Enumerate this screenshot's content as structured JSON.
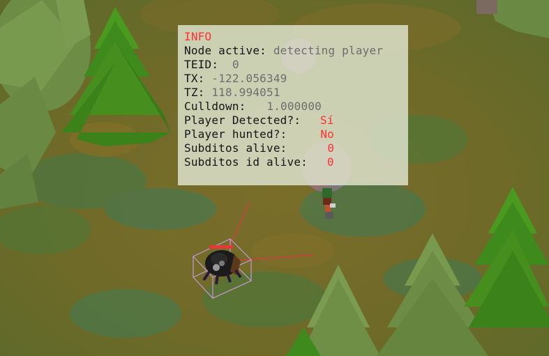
{
  "info_panel": {
    "title": "INFO",
    "rows": [
      {
        "label": "Node active:",
        "value": "detecting player"
      },
      {
        "label": "TEID:",
        "value": "0"
      },
      {
        "label": "TX:",
        "value": "-122.056349"
      },
      {
        "label": "TZ:",
        "value": "118.994051"
      },
      {
        "label": "Culldown:",
        "value": "1.000000"
      },
      {
        "label": "Player Detected?:",
        "value": "Sí"
      },
      {
        "label": "Player hunted?:",
        "value": "No"
      },
      {
        "label": "Subditos alive:",
        "value": "0"
      },
      {
        "label": "Subditos id alive:",
        "value": "0"
      }
    ]
  },
  "colors": {
    "title": "#ff3030",
    "value_gray": "#6d6d6d",
    "value_red": "#ff3030",
    "tree_dark": "#3f8a1c",
    "tree_pale": "#6e8f45",
    "ground": "#6f6f2a",
    "selection_box": "#c79ad6"
  },
  "icons": {
    "enemy": "spider-enemy-icon",
    "player": "player-character-icon",
    "detection_zone": "detection-zone-icon"
  }
}
